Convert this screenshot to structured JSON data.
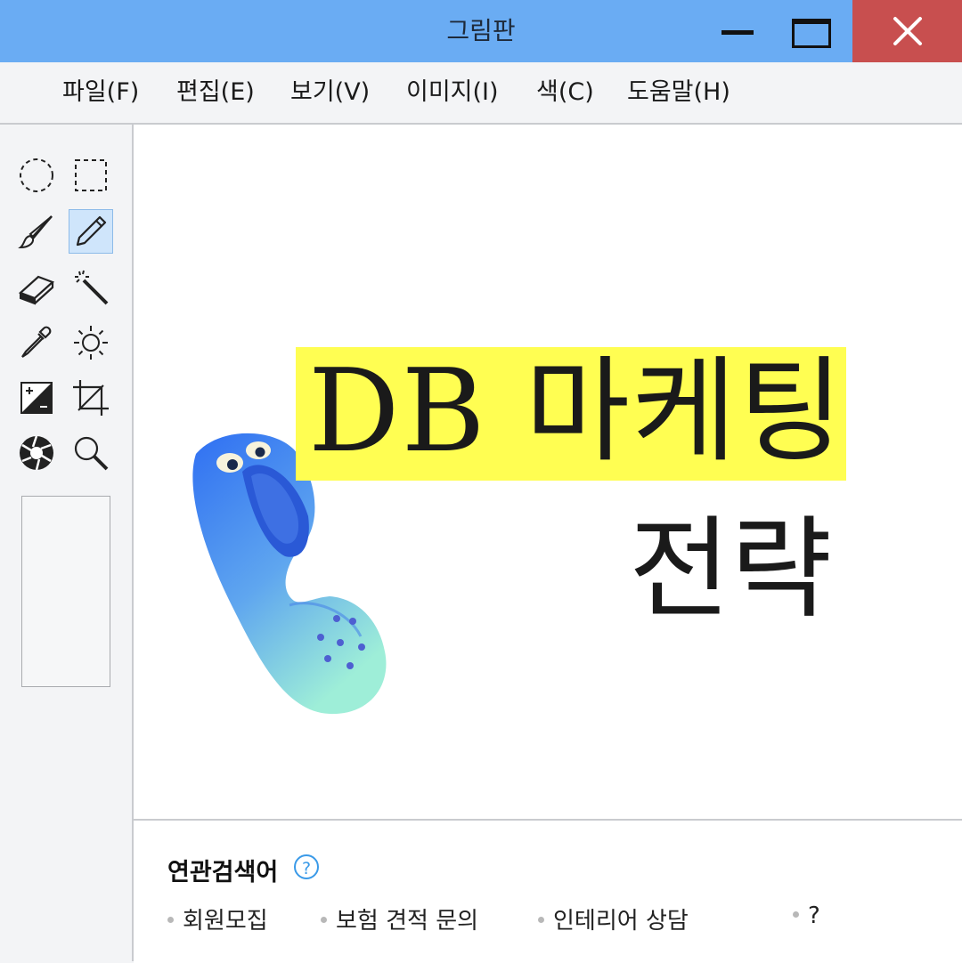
{
  "window": {
    "title": "그림판"
  },
  "menu": [
    {
      "label": "파일(F)"
    },
    {
      "label": "편집(E)"
    },
    {
      "label": "보기(V)"
    },
    {
      "label": "이미지(I)"
    },
    {
      "label": "색(C)"
    },
    {
      "label": "도움말(H)"
    }
  ],
  "tools": [
    {
      "icon": "ellipse-select-icon"
    },
    {
      "icon": "rectangle-select-icon"
    },
    {
      "icon": "brush-icon"
    },
    {
      "icon": "pencil-icon",
      "selected": true
    },
    {
      "icon": "eraser-icon"
    },
    {
      "icon": "magic-wand-icon"
    },
    {
      "icon": "eyedropper-icon"
    },
    {
      "icon": "brightness-icon"
    },
    {
      "icon": "exposure-icon"
    },
    {
      "icon": "crop-icon"
    },
    {
      "icon": "aperture-icon"
    },
    {
      "icon": "zoom-icon"
    }
  ],
  "canvas": {
    "headline": "DB 마케팅",
    "subline": "전략",
    "highlight_color": "#fffe52"
  },
  "related": {
    "title": "연관검색어",
    "help": "?",
    "keywords": [
      "회원모집",
      "보험 견적 문의",
      "인테리어 상담",
      "?"
    ]
  },
  "colors": {
    "titlebar": "#6aacf3",
    "close": "#c84f4f",
    "accent": "#3a9ae8"
  }
}
